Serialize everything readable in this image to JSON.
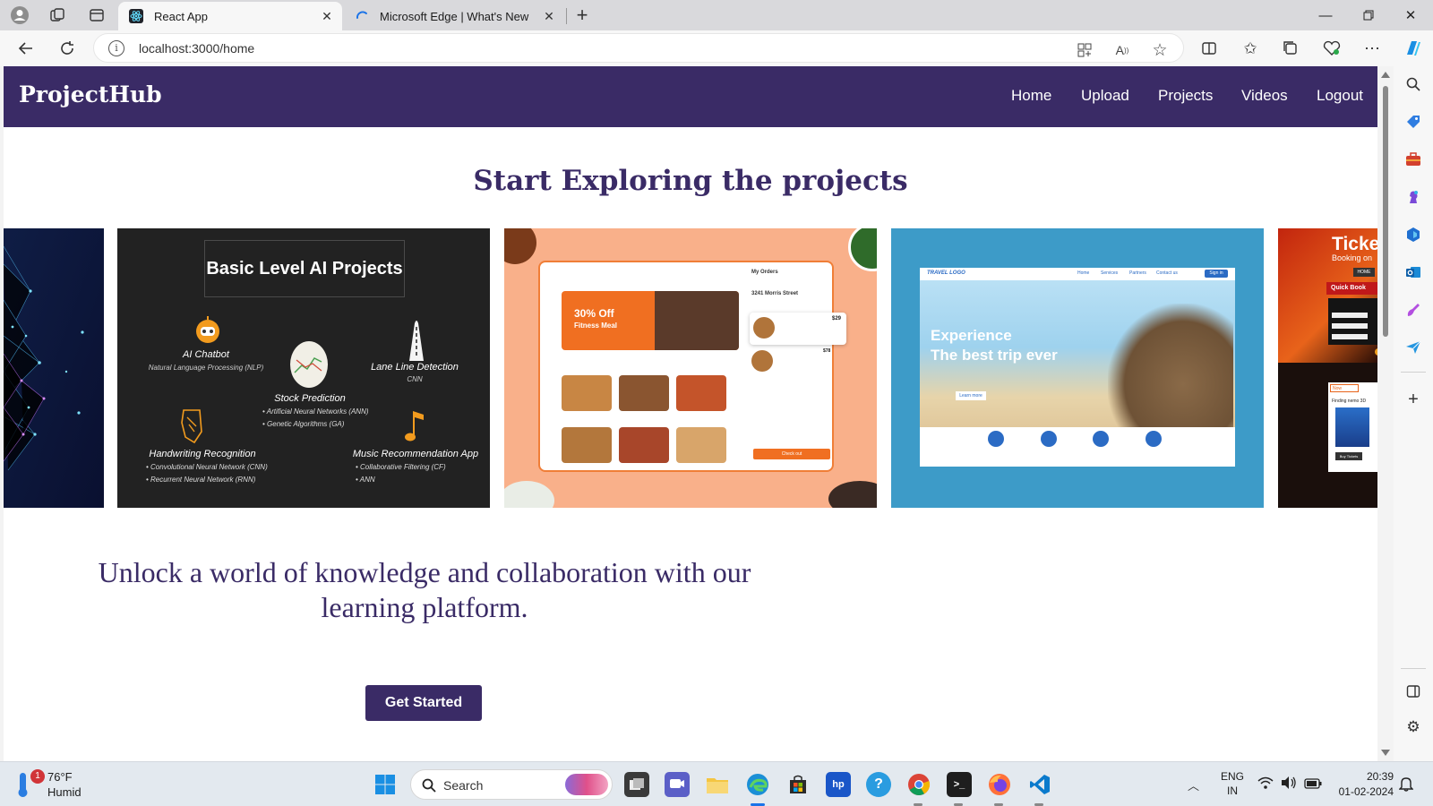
{
  "browser": {
    "tabs": [
      {
        "label": "React App",
        "active": true
      },
      {
        "label": "Microsoft Edge | What's New",
        "active": false
      }
    ],
    "address": "localhost:3000/home",
    "new_tab_glyph": "+"
  },
  "site": {
    "brand": "ProjectHub",
    "nav": [
      "Home",
      "Upload",
      "Projects",
      "Videos",
      "Logout"
    ],
    "hero_title": "Start Exploring the projects",
    "tagline": "Unlock a world of knowledge and collaboration with our learning platform.",
    "cta_label": "Get Started",
    "colors": {
      "primary": "#3a2b66",
      "white": "#ffffff"
    }
  },
  "cards": {
    "ai": {
      "heading": "Basic Level AI Projects",
      "items": [
        {
          "title": "AI Chatbot",
          "sub": "Natural Language Processing (NLP)"
        },
        {
          "title": "Stock Prediction",
          "bullets": [
            "• Artificial Neural Networks (ANN)",
            "• Genetic Algorithms (GA)"
          ]
        },
        {
          "title": "Lane Line Detection",
          "sub": "CNN"
        },
        {
          "title": "Handwriting Recognition",
          "bullets": [
            "• Convolutional Neural Network (CNN)",
            "• Recurrent Neural Network (RNN)"
          ]
        },
        {
          "title": "Music Recommendation App",
          "bullets": [
            "• Collaborative Filtering (CF)",
            "• ANN"
          ]
        }
      ]
    },
    "food": {
      "promo_1": "30% Off",
      "promo_2": "Fitness Meal",
      "orders_title": "My Orders",
      "address": "3241 Morris Street",
      "checkout": "Check out",
      "price_1": "$29",
      "price_2": "$78"
    },
    "travel": {
      "logo": "TRAVEL LOGO",
      "menu": [
        "Home",
        "Services",
        "Partners",
        "Contact us"
      ],
      "signin": "Sign in",
      "headline_1": "Experience",
      "headline_2": "The best trip ever",
      "learn_more": "Learn more"
    },
    "ticket": {
      "title": "Ticke",
      "subtitle": "Booking on",
      "quick_book": "Quick Book",
      "menu": "HOME",
      "now_showing": "Now Showing",
      "finding_nemo": "Finding nemo 3D",
      "buy": "Buy Tickets"
    }
  },
  "taskbar": {
    "weather_temp": "76°F",
    "weather_desc": "Humid",
    "weather_badge": "1",
    "search_label": "Search",
    "lang_1": "ENG",
    "lang_2": "IN",
    "time": "20:39",
    "date": "01-02-2024"
  }
}
